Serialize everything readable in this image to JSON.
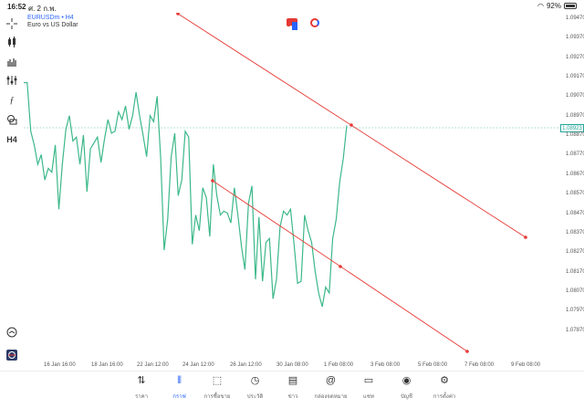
{
  "status": {
    "time": "16:52",
    "date": "ศ. 2 ก.พ.",
    "battery": "92%"
  },
  "symbol": {
    "name": "EURUSDm • H4",
    "description": "Euro vs US Dollar"
  },
  "toolbar_icons": [
    "crosshair-icon",
    "candles-icon",
    "bars-icon",
    "indicators-icon",
    "function-icon",
    "objects-icon",
    "timeframe-label"
  ],
  "timeframe": "H4",
  "price_axis": [
    "1.09470",
    "1.09370",
    "1.09270",
    "1.09170",
    "1.09070",
    "1.08970",
    "1.08870",
    "1.08770",
    "1.08670",
    "1.08570",
    "1.08470",
    "1.08370",
    "1.08270",
    "1.08170",
    "1.08070",
    "1.07970",
    "1.07870"
  ],
  "current_price": "1.08923",
  "time_axis": [
    "16 Jan 16:00",
    "18 Jan 16:00",
    "22 Jan 12:00",
    "24 Jan 12:00",
    "26 Jan 12:00",
    "30 Jan 08:00",
    "1 Feb 08:00",
    "3 Feb 08:00",
    "5 Feb 08:00",
    "7 Feb 08:00",
    "9 Feb 08:00"
  ],
  "nav": [
    {
      "label": "ราคา",
      "icon": "quotes-icon"
    },
    {
      "label": "กราฟ",
      "icon": "chart-icon",
      "active": true
    },
    {
      "label": "การซื้อขาย",
      "icon": "trade-icon"
    },
    {
      "label": "ประวัติ",
      "icon": "history-icon"
    },
    {
      "label": "ข่าว",
      "icon": "news-icon"
    },
    {
      "label": "กล่องจดหมาย",
      "icon": "mailbox-icon"
    },
    {
      "label": "แชท",
      "icon": "chat-icon"
    },
    {
      "label": "บัญชี",
      "icon": "account-icon"
    },
    {
      "label": "การตั้งค่า",
      "icon": "settings-icon"
    }
  ],
  "colors": {
    "line": "#3cb88a",
    "trendline": "#e53935",
    "accent": "#2962ff"
  },
  "chart_data": {
    "type": "line",
    "series": [
      {
        "values": [
          1.0914,
          1.0914,
          1.0889,
          1.0882,
          1.0872,
          1.0877,
          1.0864,
          1.087,
          1.0868,
          1.0882,
          1.0849,
          1.0872,
          1.089,
          1.0897,
          1.0884,
          1.0886,
          1.0872,
          1.0887,
          1.0858,
          1.088,
          1.0883,
          1.0886,
          1.0873,
          1.0885,
          1.0895,
          1.0888,
          1.0889,
          1.0899,
          1.0895,
          1.0902,
          1.089,
          1.0897,
          1.0909,
          1.0897,
          1.0887,
          1.0876,
          1.0897,
          1.0894,
          1.0907,
          1.0875,
          1.0828,
          1.0844,
          1.0876,
          1.0888,
          1.0856,
          1.0864,
          1.0889,
          1.0886,
          1.0831,
          1.0846,
          1.0838,
          1.086,
          1.0855,
          1.0835,
          1.0872,
          1.0856,
          1.0846,
          1.0848,
          1.0847,
          1.0842,
          1.086,
          1.0846,
          1.083,
          1.0818,
          1.0852,
          1.0861,
          1.0813,
          1.0845,
          1.0812,
          1.0832,
          1.0834,
          1.0803,
          1.0813,
          1.084,
          1.0848,
          1.0846,
          1.0849,
          1.0831,
          1.0811,
          1.0812,
          1.0846,
          1.0838,
          1.0832,
          1.0817,
          1.0806,
          1.0799,
          1.0809,
          1.0806,
          1.0834,
          1.0844,
          1.0863,
          1.0875,
          1.0892
        ]
      }
    ],
    "trendlines": [
      {
        "from": [
          "~15 Jan",
          1.0955
        ],
        "to": [
          "9 Feb 08:00",
          1.0838
        ]
      },
      {
        "from": [
          "~24 Jan",
          1.0867
        ],
        "to": [
          "7 Feb 08:00",
          1.0786
        ]
      }
    ],
    "current_price": 1.08923
  }
}
